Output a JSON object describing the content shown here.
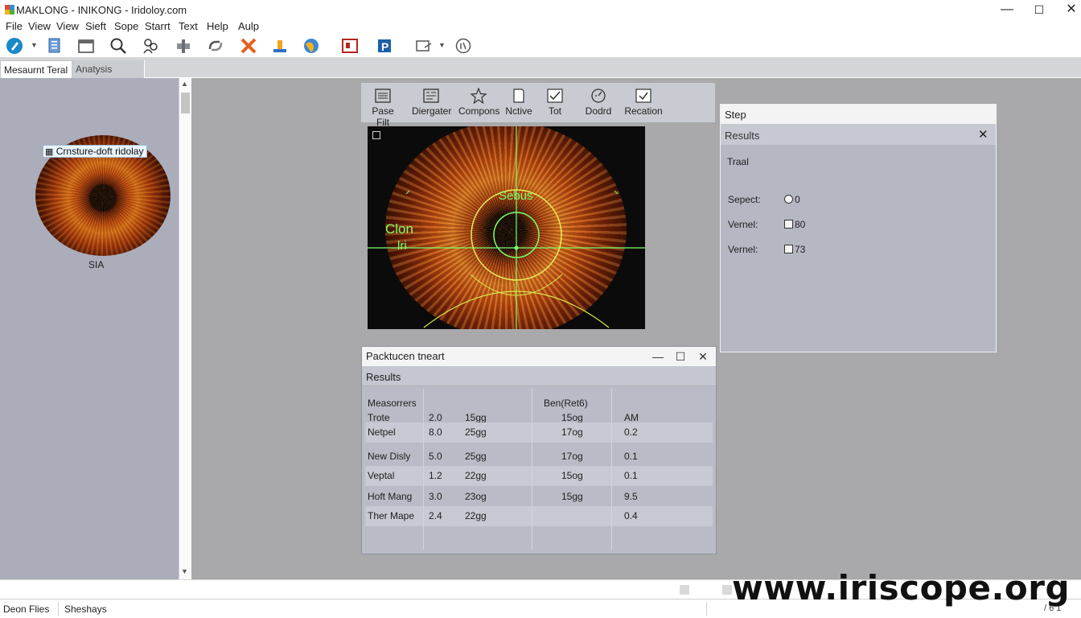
{
  "window": {
    "title": "MAKLONG - INIKONG - Iridoloy.com",
    "controls": [
      "—",
      "☐",
      "✕"
    ]
  },
  "menu": [
    "File",
    "View",
    "View",
    "Sieft",
    "Sope",
    "Starrt",
    "Text",
    "Help",
    "Aulp"
  ],
  "tabs": [
    "Mesaurnt Teral",
    "Anatysis"
  ],
  "left_panel": {
    "thumb_label": "Crnsture-doft ridolay",
    "thumb_caption": "SIA"
  },
  "center_tools": [
    {
      "label": "Pase Filt",
      "icon": "list-icon"
    },
    {
      "label": "Diergater",
      "icon": "document-list-icon"
    },
    {
      "label": "Compons",
      "icon": "star-icon"
    },
    {
      "label": "Nctive",
      "icon": "page-icon"
    },
    {
      "label": "Tot",
      "icon": "checkbox-icon"
    },
    {
      "label": "Dodrd",
      "icon": "gauge-icon"
    },
    {
      "label": "Recation",
      "icon": "check-icon"
    }
  ],
  "iris_view": {
    "overlay_labels": [
      "Sebus",
      "Clon",
      "lri"
    ]
  },
  "results_window": {
    "title": "Packtucen tneart",
    "controls": [
      "—",
      "☐",
      "✕"
    ],
    "results_label": "Results",
    "header_row1": {
      "col0": "Measorrers",
      "col3": "Ben(Ret6)"
    },
    "rows": [
      [
        "Trote",
        "2.0",
        "15gg",
        "15og",
        "AM"
      ],
      [
        "Netpel",
        "8.0",
        "25gg",
        "17og",
        "0.2"
      ],
      [
        "New Disly",
        "5.0",
        "25gg",
        "17og",
        "0.1"
      ],
      [
        "Veptal",
        "1.2",
        "22gg",
        "15og",
        "0.1"
      ],
      [
        "Hoft Mang",
        "3.0",
        "23og",
        "15gg",
        "9.5"
      ],
      [
        "Ther Mape",
        "2.4",
        "22gg",
        "",
        "0.4"
      ]
    ]
  },
  "step_panel": {
    "title": "Step",
    "results_label": "Results",
    "close": "✕",
    "trial_label": "Traal",
    "items": [
      {
        "label": "Sepect:",
        "control": "radio",
        "value": "0"
      },
      {
        "label": "Vernel:",
        "control": "checkbox",
        "value": "80"
      },
      {
        "label": "Vernel:",
        "control": "checkbox",
        "value": "73"
      }
    ]
  },
  "status_bar": {
    "files": "Deon Flies",
    "shapes": "Sheshays",
    "zoom": "/ 6 1"
  },
  "watermark": "www.iriscope.org",
  "colors": {
    "accent_green": "#7fff6a",
    "panel_bg": "#b9bcc6",
    "workspace_bg": "#a9a9ab"
  }
}
